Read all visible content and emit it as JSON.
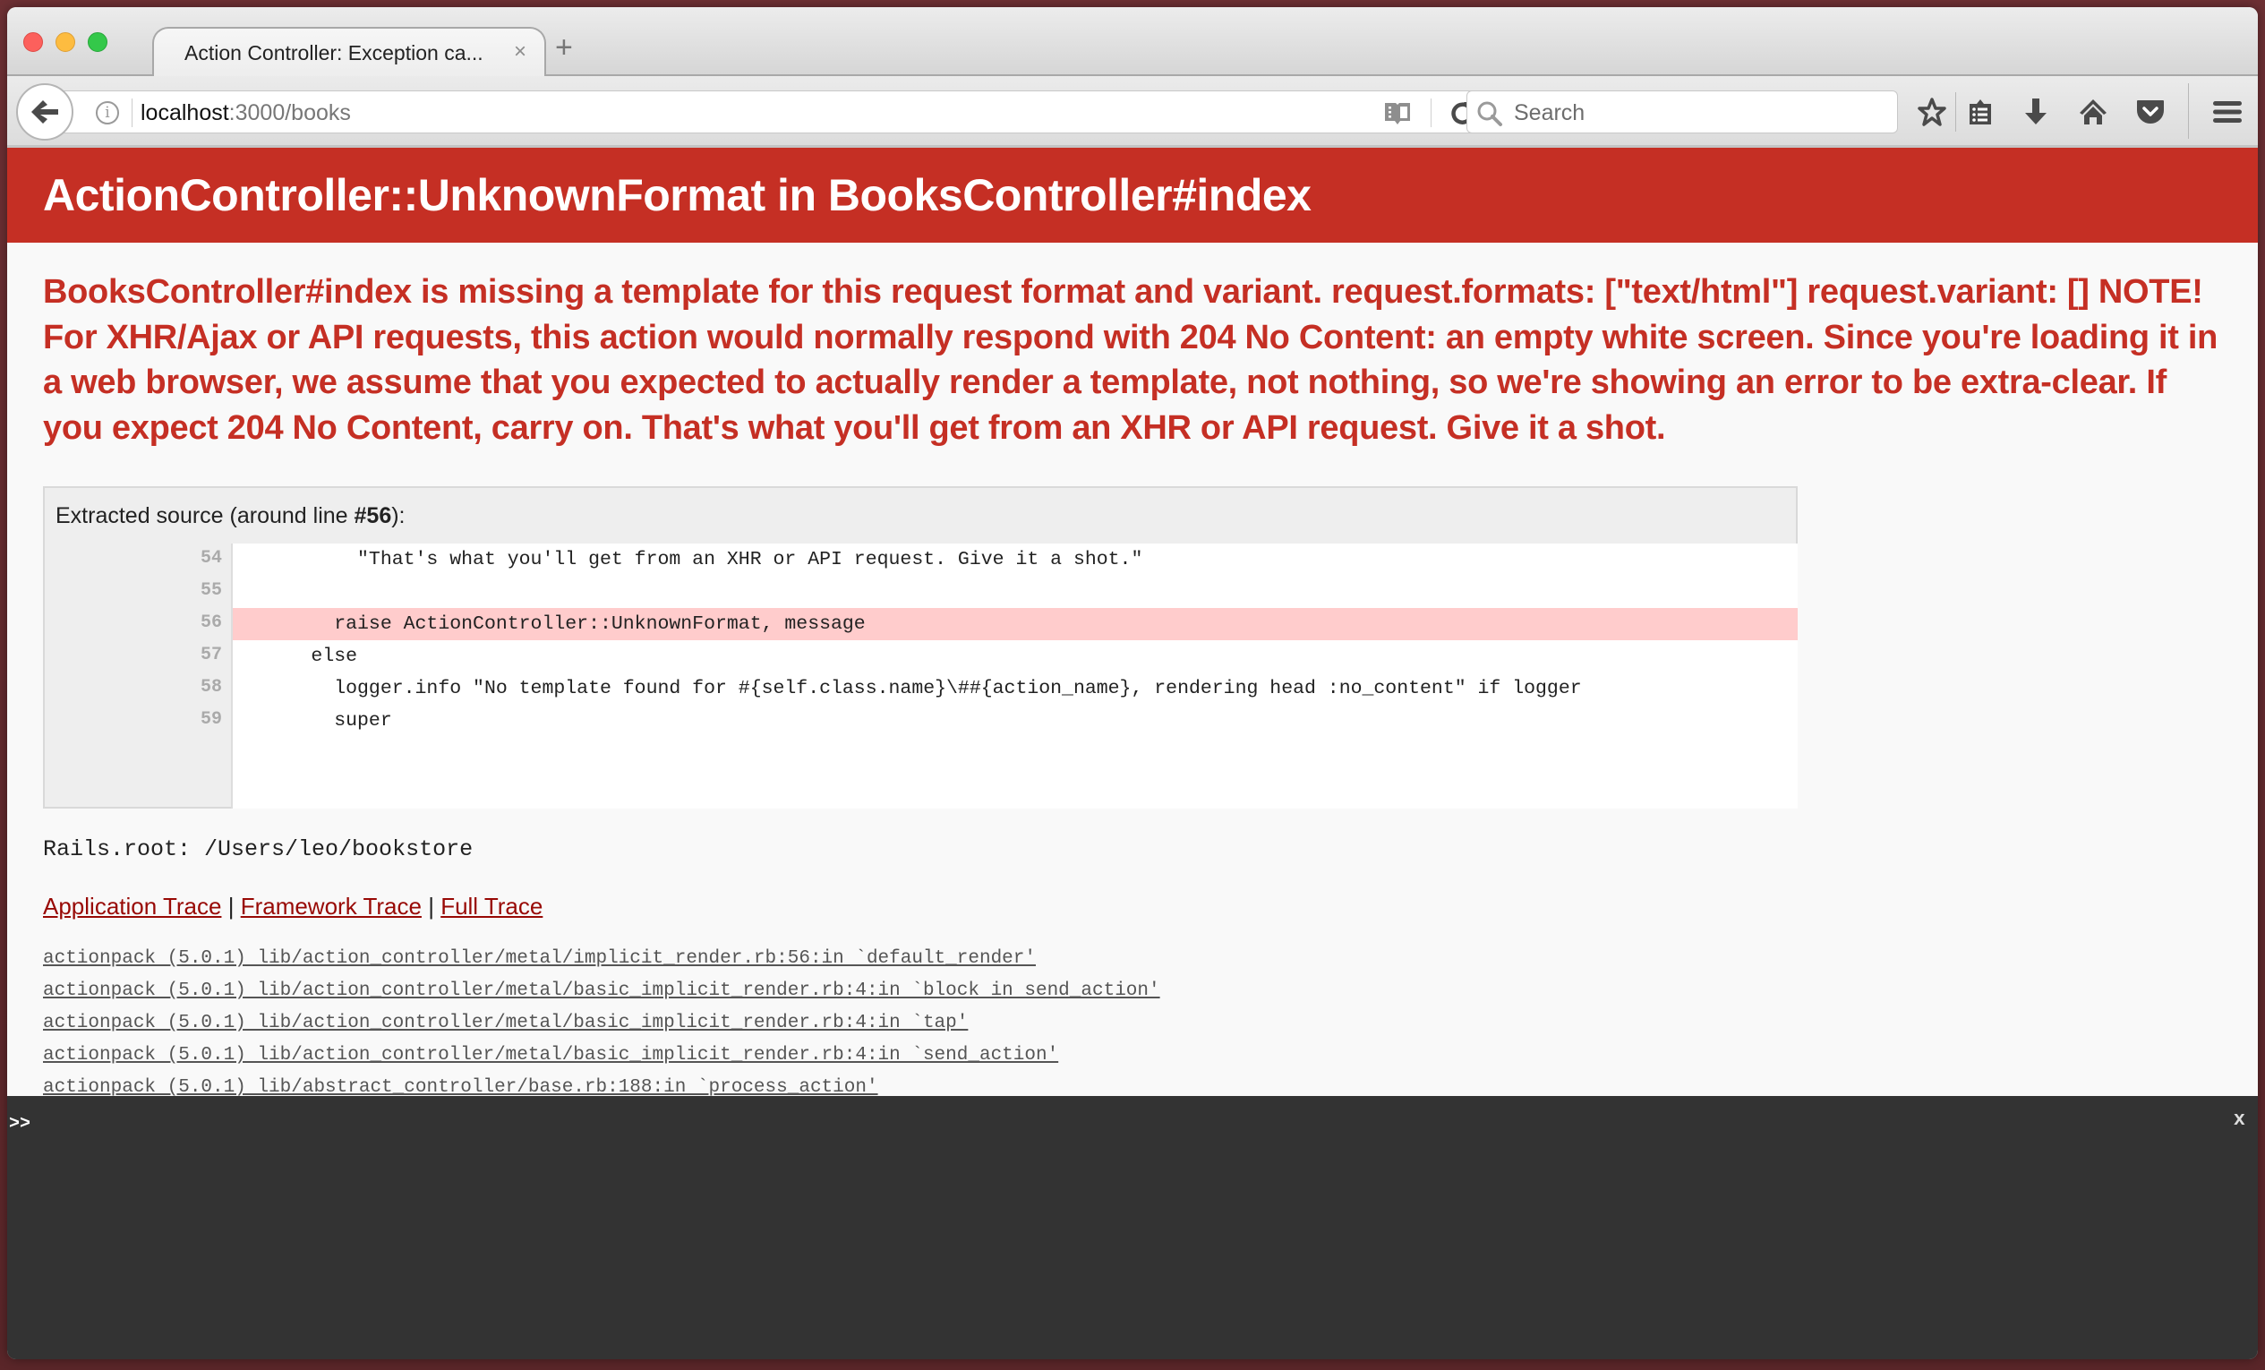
{
  "browser": {
    "tab": {
      "title": "Action Controller: Exception ca...",
      "close_glyph": "×"
    },
    "new_tab_glyph": "+",
    "url": {
      "host": "localhost",
      "rest": ":3000/books"
    },
    "search": {
      "placeholder": "Search",
      "value": ""
    },
    "icons": [
      "back-arrow-icon",
      "info-icon",
      "reader-view-icon",
      "reload-icon",
      "search-icon",
      "bookmark-star-icon",
      "bookmarks-list-icon",
      "downloads-icon",
      "home-icon",
      "pocket-icon",
      "hamburger-menu-icon"
    ]
  },
  "page": {
    "title": "ActionController::UnknownFormat in BooksController#index",
    "error_message": "BooksController#index is missing a template for this request format and variant. request.formats: [\"text/html\"] request.variant: [] NOTE! For XHR/Ajax or API requests, this action would normally respond with 204 No Content: an empty white screen. Since you're loading it in a web browser, we assume that you expected to actually render a template, not nothing, so we're showing an error to be extra-clear. If you expect 204 No Content, carry on. That's what you'll get from an XHR or API request. Give it a shot.",
    "source": {
      "caption_prefix": "Extracted source (around line ",
      "caption_line": "#56",
      "caption_suffix": "):",
      "lines": [
        {
          "num": "54",
          "code": "          \"That's what you'll get from an XHR or API request. Give it a shot.\"",
          "highlight": false
        },
        {
          "num": "55",
          "code": "",
          "highlight": false
        },
        {
          "num": "56",
          "code": "        raise ActionController::UnknownFormat, message",
          "highlight": true
        },
        {
          "num": "57",
          "code": "      else",
          "highlight": false
        },
        {
          "num": "58",
          "code": "        logger.info \"No template found for #{self.class.name}\\##{action_name}, rendering head :no_content\" if logger",
          "highlight": false
        },
        {
          "num": "59",
          "code": "        super",
          "highlight": false
        }
      ]
    },
    "rails_root": "Rails.root: /Users/leo/bookstore",
    "trace_links": {
      "application": "Application Trace",
      "framework": "Framework Trace",
      "full": "Full Trace",
      "separator": "|"
    },
    "trace": [
      "actionpack (5.0.1) lib/action_controller/metal/implicit_render.rb:56:in `default_render'",
      "actionpack (5.0.1) lib/action_controller/metal/basic_implicit_render.rb:4:in `block in send_action'",
      "actionpack (5.0.1) lib/action_controller/metal/basic_implicit_render.rb:4:in `tap'",
      "actionpack (5.0.1) lib/action_controller/metal/basic_implicit_render.rb:4:in `send_action'",
      "actionpack (5.0.1) lib/abstract_controller/base.rb:188:in `process_action'"
    ]
  },
  "console": {
    "prompt": ">>",
    "value": "",
    "close_label": "x"
  },
  "colors": {
    "header_red": "#c52f24",
    "link_red": "#980905",
    "highlight_line": "#ffcccc",
    "console_bg": "#333333"
  }
}
